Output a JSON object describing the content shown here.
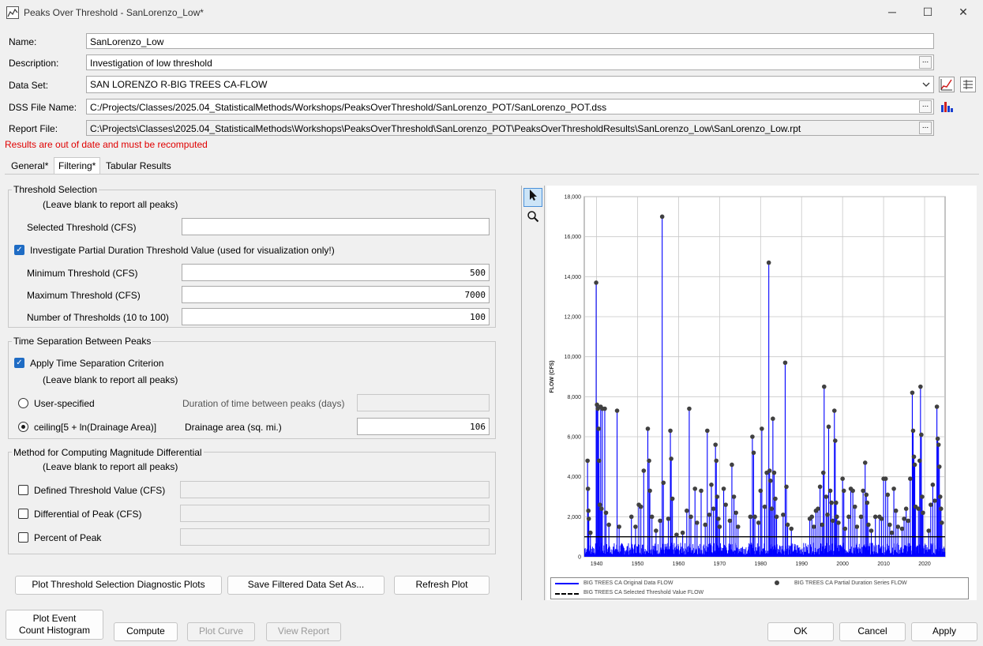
{
  "window": {
    "title": "Peaks Over Threshold - SanLorenzo_Low*",
    "minimize": "─",
    "maximize": "☐",
    "close": "✕"
  },
  "form": {
    "name_label": "Name:",
    "name_value": "SanLorenzo_Low",
    "description_label": "Description:",
    "description_value": "Investigation of low threshold",
    "dataset_label": "Data Set:",
    "dataset_value": "SAN LORENZO R-BIG TREES CA-FLOW",
    "dss_label": "DSS File Name:",
    "dss_value": "C:/Projects/Classes/2025.04_StatisticalMethods/Workshops/PeaksOverThreshold/SanLorenzo_POT/SanLorenzo_POT.dss",
    "report_label": "Report File:",
    "report_value": "C:\\Projects\\Classes\\2025.04_StatisticalMethods\\Workshops\\PeaksOverThreshold\\SanLorenzo_POT\\PeaksOverThresholdResults\\SanLorenzo_Low\\SanLorenzo_Low.rpt",
    "browse": "...",
    "warning": "Results are out of date and must be recomputed"
  },
  "tabs": [
    {
      "label": "General*"
    },
    {
      "label": "Filtering*"
    },
    {
      "label": "Tabular Results"
    }
  ],
  "threshold": {
    "title": "Threshold Selection",
    "hint": "(Leave blank to report all peaks)",
    "selected_label": "Selected Threshold (CFS)",
    "selected_value": "",
    "investigate_label": "Investigate Partial Duration Threshold Value (used for visualization only!)",
    "investigate_checked": true,
    "min_label": "Minimum Threshold (CFS)",
    "min_value": "500",
    "max_label": "Maximum Threshold (CFS)",
    "max_value": "7000",
    "num_label": "Number of Thresholds (10 to 100)",
    "num_value": "100"
  },
  "separation": {
    "title": "Time Separation Between Peaks",
    "apply_label": "Apply Time Separation Criterion",
    "apply_checked": true,
    "hint": "(Leave blank to report all peaks)",
    "user_label": "User-specified",
    "duration_label": "Duration of time between peaks (days)",
    "duration_value": "",
    "ceiling_label": "ceiling[5 + ln(Drainage Area)]",
    "ceiling_selected": true,
    "drainage_label": "Drainage area (sq. mi.)",
    "drainage_value": "106"
  },
  "magnitude": {
    "title": "Method for Computing Magnitude Differential",
    "hint": "(Leave blank to report all peaks)",
    "defined_label": "Defined Threshold Value (CFS)",
    "differential_label": "Differential of Peak (CFS)",
    "percent_label": "Percent of Peak"
  },
  "buttons": {
    "plot_diag": "Plot Threshold Selection Diagnostic Plots",
    "save_filtered": "Save Filtered Data Set As...",
    "refresh": "Refresh Plot",
    "plot_event_1": "Plot Event",
    "plot_event_2": "Count Histogram",
    "compute": "Compute",
    "plot_curve": "Plot Curve",
    "view_report": "View Report",
    "ok": "OK",
    "cancel": "Cancel",
    "apply": "Apply"
  },
  "chart_data": {
    "type": "line",
    "ylabel": "FLOW (CFS)",
    "xlabel": "",
    "ylim": [
      0,
      18000
    ],
    "xlim": [
      1937,
      2025
    ],
    "y_ticks": [
      0,
      2000,
      4000,
      6000,
      8000,
      10000,
      12000,
      14000,
      16000,
      18000
    ],
    "y_tick_labels": [
      "0",
      "2,000",
      "4,000",
      "6,000",
      "8,000",
      "10,000",
      "12,000",
      "14,000",
      "16,000",
      "18,000"
    ],
    "x_ticks": [
      1940,
      1950,
      1960,
      1970,
      1980,
      1990,
      2000,
      2010,
      2020
    ],
    "x_tick_labels": [
      "1940",
      "1950",
      "1960",
      "1970",
      "1980",
      "1990",
      "2000",
      "2010",
      "2020"
    ],
    "grid": true,
    "legend_placement": "bottom",
    "threshold": 1000,
    "series": [
      {
        "name": "BIG TREES CA Original Data FLOW",
        "color": "#0000ff"
      },
      {
        "name": "BIG TREES CA Partial Duration Series FLOW",
        "color": "#404040"
      },
      {
        "name": "BIG TREES CA Selected Threshold Value FLOW",
        "color": "#000000"
      }
    ],
    "peaks": [
      [
        1937.8,
        4800
      ],
      [
        1937.9,
        3400
      ],
      [
        1938.0,
        2300
      ],
      [
        1938.1,
        1900
      ],
      [
        1938.5,
        1200
      ],
      [
        1939.9,
        13700
      ],
      [
        1940.1,
        7600
      ],
      [
        1940.3,
        7400
      ],
      [
        1940.5,
        6400
      ],
      [
        1940.6,
        4800
      ],
      [
        1940.8,
        2600
      ],
      [
        1941.0,
        7500
      ],
      [
        1941.2,
        2400
      ],
      [
        1941.4,
        7400
      ],
      [
        1942.0,
        7400
      ],
      [
        1942.3,
        2200
      ],
      [
        1943.0,
        1600
      ],
      [
        1945.0,
        7300
      ],
      [
        1945.5,
        1500
      ],
      [
        1948.5,
        2000
      ],
      [
        1949.5,
        1500
      ],
      [
        1950.3,
        2600
      ],
      [
        1950.8,
        2500
      ],
      [
        1951.5,
        4300
      ],
      [
        1952.5,
        6400
      ],
      [
        1952.8,
        4800
      ],
      [
        1953.0,
        3300
      ],
      [
        1953.5,
        2000
      ],
      [
        1954.5,
        1300
      ],
      [
        1955.5,
        1800
      ],
      [
        1956.0,
        17000
      ],
      [
        1956.3,
        3700
      ],
      [
        1957.5,
        1900
      ],
      [
        1958.0,
        6300
      ],
      [
        1958.2,
        4900
      ],
      [
        1958.5,
        2900
      ],
      [
        1959.5,
        1100
      ],
      [
        1961.0,
        1200
      ],
      [
        1962.0,
        2300
      ],
      [
        1962.6,
        7400
      ],
      [
        1963.0,
        2000
      ],
      [
        1964.0,
        3400
      ],
      [
        1964.5,
        1700
      ],
      [
        1965.5,
        3300
      ],
      [
        1966.5,
        1600
      ],
      [
        1967.0,
        6300
      ],
      [
        1967.5,
        2100
      ],
      [
        1968.0,
        3600
      ],
      [
        1968.5,
        2400
      ],
      [
        1969.0,
        5600
      ],
      [
        1969.2,
        4800
      ],
      [
        1969.4,
        3000
      ],
      [
        1969.7,
        1900
      ],
      [
        1970.0,
        1500
      ],
      [
        1971.0,
        3400
      ],
      [
        1971.5,
        2600
      ],
      [
        1972.5,
        1800
      ],
      [
        1973.0,
        4600
      ],
      [
        1973.5,
        3000
      ],
      [
        1974.0,
        2200
      ],
      [
        1974.5,
        1500
      ],
      [
        1977.5,
        2000
      ],
      [
        1978.0,
        6000
      ],
      [
        1978.3,
        5200
      ],
      [
        1978.6,
        2000
      ],
      [
        1979.5,
        1700
      ],
      [
        1980.0,
        3300
      ],
      [
        1980.3,
        6400
      ],
      [
        1981.0,
        2500
      ],
      [
        1981.5,
        4200
      ],
      [
        1982.0,
        14700
      ],
      [
        1982.2,
        4300
      ],
      [
        1982.4,
        3800
      ],
      [
        1982.7,
        2400
      ],
      [
        1983.0,
        6900
      ],
      [
        1983.3,
        4200
      ],
      [
        1983.6,
        2900
      ],
      [
        1983.9,
        2000
      ],
      [
        1985.5,
        2100
      ],
      [
        1986.0,
        9700
      ],
      [
        1986.3,
        3500
      ],
      [
        1986.6,
        1600
      ],
      [
        1987.5,
        1400
      ],
      [
        1992.0,
        1900
      ],
      [
        1992.5,
        2000
      ],
      [
        1993.0,
        1500
      ],
      [
        1993.5,
        2300
      ],
      [
        1994.0,
        2400
      ],
      [
        1994.5,
        3500
      ],
      [
        1995.0,
        1600
      ],
      [
        1995.3,
        4200
      ],
      [
        1995.5,
        8500
      ],
      [
        1996.0,
        3000
      ],
      [
        1996.3,
        2100
      ],
      [
        1996.6,
        6500
      ],
      [
        1997.0,
        3300
      ],
      [
        1997.3,
        2700
      ],
      [
        1997.6,
        1800
      ],
      [
        1998.0,
        7300
      ],
      [
        1998.2,
        5800
      ],
      [
        1998.4,
        2700
      ],
      [
        1998.6,
        2000
      ],
      [
        1999.0,
        1700
      ],
      [
        2000.0,
        3900
      ],
      [
        2000.3,
        3300
      ],
      [
        2000.6,
        1400
      ],
      [
        2001.5,
        2000
      ],
      [
        2002.0,
        3400
      ],
      [
        2002.5,
        3300
      ],
      [
        2003.0,
        2500
      ],
      [
        2003.5,
        1500
      ],
      [
        2004.5,
        2000
      ],
      [
        2005.0,
        3300
      ],
      [
        2005.5,
        4700
      ],
      [
        2005.8,
        3100
      ],
      [
        2006.0,
        2700
      ],
      [
        2006.3,
        1600
      ],
      [
        2007.0,
        1300
      ],
      [
        2008.0,
        2000
      ],
      [
        2009.0,
        2000
      ],
      [
        2009.5,
        1900
      ],
      [
        2010.0,
        3900
      ],
      [
        2010.5,
        3900
      ],
      [
        2011.0,
        3100
      ],
      [
        2011.5,
        1600
      ],
      [
        2012.0,
        1200
      ],
      [
        2012.5,
        3400
      ],
      [
        2013.0,
        2300
      ],
      [
        2013.5,
        1500
      ],
      [
        2014.5,
        1400
      ],
      [
        2015.0,
        1900
      ],
      [
        2015.5,
        2400
      ],
      [
        2016.0,
        1800
      ],
      [
        2016.5,
        3900
      ],
      [
        2017.0,
        8200
      ],
      [
        2017.2,
        6300
      ],
      [
        2017.4,
        5000
      ],
      [
        2017.6,
        4600
      ],
      [
        2017.8,
        2500
      ],
      [
        2018.5,
        2400
      ],
      [
        2018.8,
        4800
      ],
      [
        2019.0,
        8500
      ],
      [
        2019.2,
        6100
      ],
      [
        2019.4,
        3000
      ],
      [
        2019.6,
        2200
      ],
      [
        2021.0,
        1300
      ],
      [
        2021.5,
        2600
      ],
      [
        2022.0,
        3600
      ],
      [
        2022.5,
        2800
      ],
      [
        2023.0,
        7500
      ],
      [
        2023.2,
        5900
      ],
      [
        2023.4,
        5600
      ],
      [
        2023.6,
        4500
      ],
      [
        2023.8,
        3000
      ],
      [
        2024.0,
        2400
      ],
      [
        2024.2,
        1700
      ]
    ]
  }
}
